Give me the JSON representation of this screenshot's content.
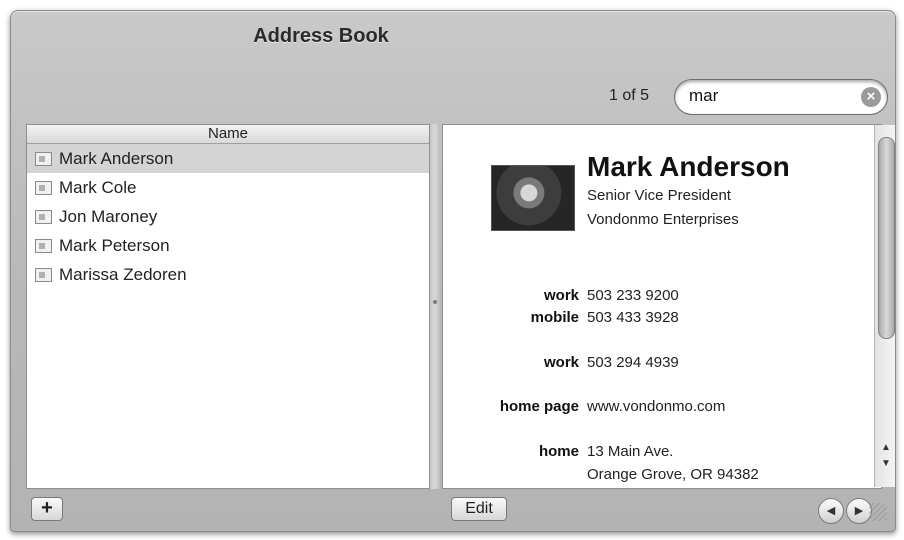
{
  "window": {
    "title": "Address Book"
  },
  "search": {
    "result_count": "1 of 5",
    "value": "mar"
  },
  "list": {
    "header": "Name",
    "rows": [
      {
        "name": "Mark Anderson",
        "selected": true
      },
      {
        "name": "Mark Cole",
        "selected": false
      },
      {
        "name": "Jon Maroney",
        "selected": false
      },
      {
        "name": "Mark Peterson",
        "selected": false
      },
      {
        "name": "Marissa Zedoren",
        "selected": false
      }
    ]
  },
  "card": {
    "name": "Mark Anderson",
    "job_title": "Senior Vice President",
    "company": "Vondonmo Enterprises",
    "fields": [
      {
        "label": "work",
        "value": "503 233 9200"
      },
      {
        "label": "mobile",
        "value": "503 433 3928"
      },
      {
        "label": "work",
        "value": "503 294 4939"
      },
      {
        "label": "home page",
        "value": "www.vondonmo.com"
      },
      {
        "label": "home",
        "value": "13 Main Ave.",
        "value2": "Orange Grove, OR 94382"
      }
    ]
  },
  "buttons": {
    "add": "+",
    "edit": "Edit",
    "prev": "◀",
    "next": "▶"
  },
  "icons": {
    "clear": "clear-search-icon",
    "card": "contact-card-icon",
    "scroll_up": "scroll-up-arrow-icon",
    "scroll_down": "scroll-down-arrow-icon",
    "resize": "resize-grip-icon"
  }
}
